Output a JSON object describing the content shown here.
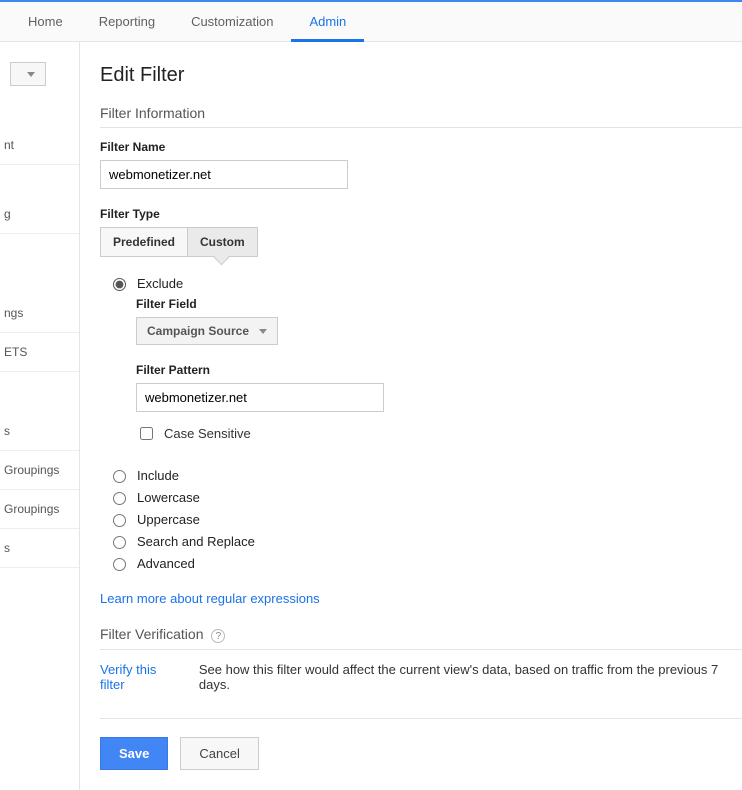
{
  "nav": {
    "tabs": [
      "Home",
      "Reporting",
      "Customization",
      "Admin"
    ],
    "active": "Admin"
  },
  "sidebar": {
    "items": [
      "nt",
      "g",
      "ngs",
      "ETS",
      "s",
      "Groupings",
      "Groupings",
      "s"
    ]
  },
  "page": {
    "title": "Edit Filter",
    "info_heading": "Filter Information",
    "name_label": "Filter Name",
    "name_value": "webmonetizer.net",
    "type_label": "Filter Type",
    "type_options": {
      "predefined": "Predefined",
      "custom": "Custom"
    },
    "type_selected": "custom",
    "filter_modes": {
      "exclude": "Exclude",
      "include": "Include",
      "lowercase": "Lowercase",
      "uppercase": "Uppercase",
      "search_replace": "Search and Replace",
      "advanced": "Advanced"
    },
    "mode_selected": "exclude",
    "field_label": "Filter Field",
    "field_value": "Campaign Source",
    "pattern_label": "Filter Pattern",
    "pattern_value": "webmonetizer.net",
    "case_sensitive_label": "Case Sensitive",
    "case_sensitive": false,
    "regex_link": "Learn more about regular expressions",
    "verification_heading": "Filter Verification",
    "verify_link": "Verify this filter",
    "verify_text": "See how this filter would affect the current view's data, based on traffic from the previous 7 days.",
    "save_label": "Save",
    "cancel_label": "Cancel"
  }
}
